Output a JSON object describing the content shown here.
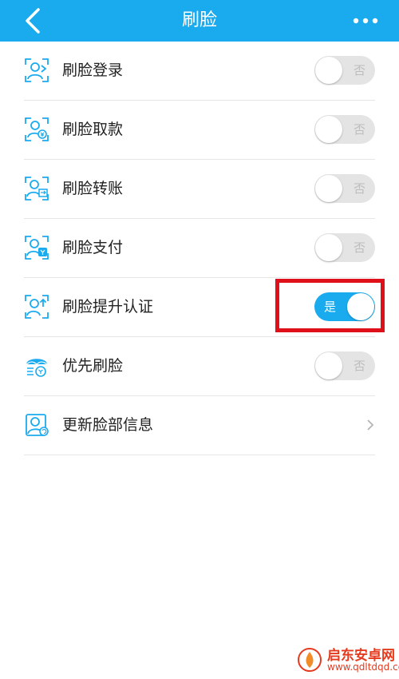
{
  "header": {
    "title": "刷脸",
    "back_icon": "chevron-left-icon",
    "more_icon": "more-dots-icon",
    "background": "#1aabef"
  },
  "rows": [
    {
      "label": "刷脸登录",
      "icon": "face-login-icon",
      "control": "toggle",
      "state": "off",
      "toggle_text": "否"
    },
    {
      "label": "刷脸取款",
      "icon": "face-withdraw-icon",
      "control": "toggle",
      "state": "off",
      "toggle_text": "否"
    },
    {
      "label": "刷脸转账",
      "icon": "face-transfer-icon",
      "control": "toggle",
      "state": "off",
      "toggle_text": "否"
    },
    {
      "label": "刷脸支付",
      "icon": "face-pay-icon",
      "control": "toggle",
      "state": "off",
      "toggle_text": "否"
    },
    {
      "label": "刷脸提升认证",
      "icon": "face-upgrade-icon",
      "control": "toggle",
      "state": "on",
      "toggle_text": "是"
    },
    {
      "label": "优先刷脸",
      "icon": "face-priority-icon",
      "control": "toggle",
      "state": "off",
      "toggle_text": "否"
    },
    {
      "label": "更新脸部信息",
      "icon": "face-update-icon",
      "control": "chevron"
    }
  ],
  "watermark": {
    "text": "启东安卓网",
    "url": "www.qdltdqd.com"
  },
  "colors": {
    "accent": "#1aabef",
    "highlight": "#e0101a",
    "toggle_off": "#e4e4e4"
  }
}
